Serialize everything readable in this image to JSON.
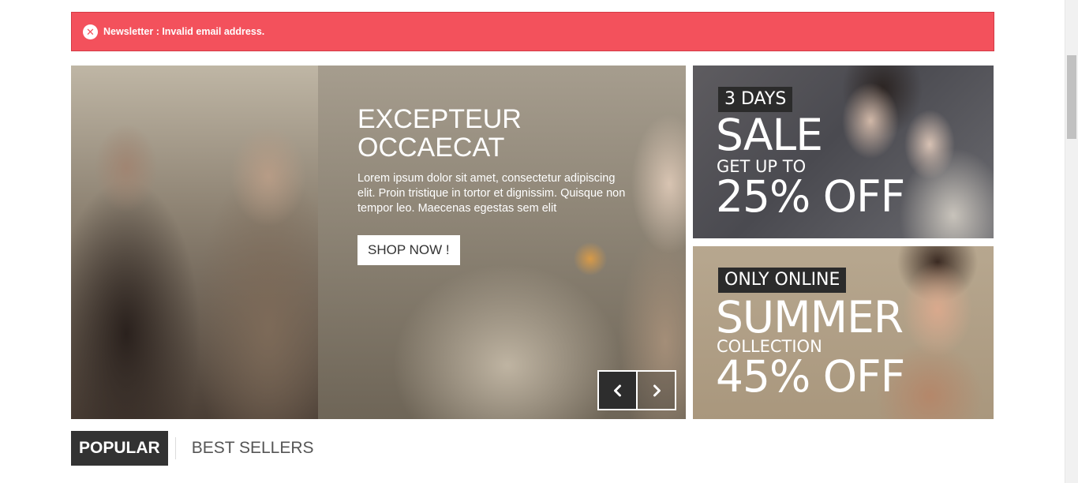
{
  "alert": {
    "icon": "close-circle-icon",
    "message": "Newsletter : Invalid email address.",
    "color": "#f3515c"
  },
  "slider": {
    "title_line1": "EXCEPTEUR",
    "title_line2": "OCCAECAT",
    "description": "Lorem ipsum dolor sit amet, consectetur adipiscing elit. Proin tristique in tortor et dignissim. Quisque non tempor leo. Maecenas egestas sem elit",
    "button_label": "SHOP NOW !",
    "prev_icon": "chevron-left-icon",
    "next_icon": "chevron-right-icon"
  },
  "banners": [
    {
      "tag": "3 DAYS",
      "headline": "SALE",
      "subline": "GET UP TO",
      "offer": "25% OFF"
    },
    {
      "tag": "ONLY ONLINE",
      "headline": "SUMMER",
      "subline": "COLLECTION",
      "offer": "45% OFF"
    }
  ],
  "tabs": [
    {
      "label": "POPULAR",
      "active": true
    },
    {
      "label": "BEST SELLERS",
      "active": false
    }
  ]
}
